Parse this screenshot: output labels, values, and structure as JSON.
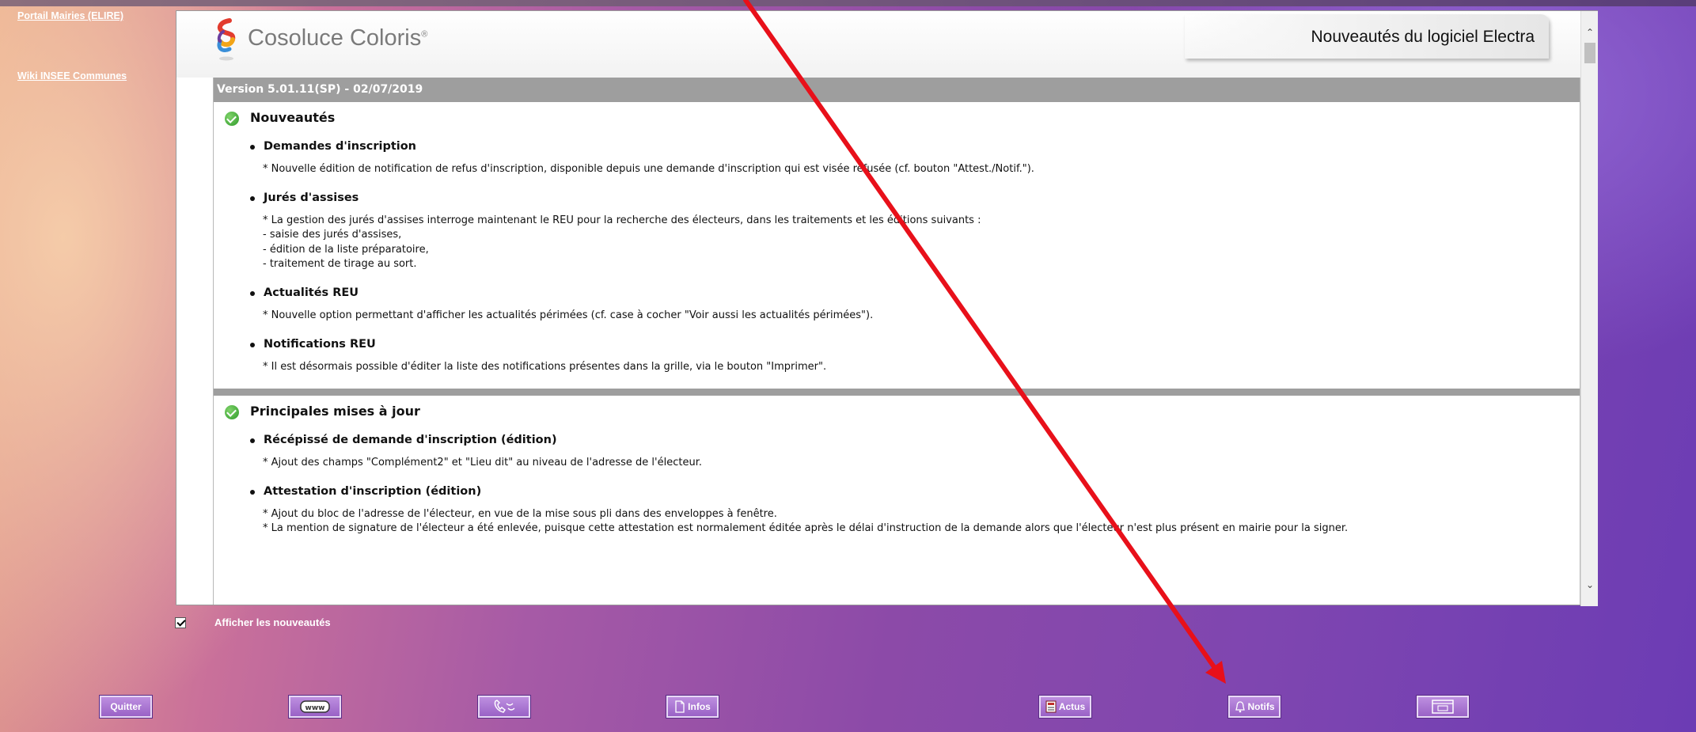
{
  "sidebar": {
    "links": [
      {
        "label": "Portail Mairies (ELIRE)"
      },
      {
        "label": "Wiki INSEE Communes"
      }
    ]
  },
  "header": {
    "brand": "Cosoluce Coloris",
    "registered": "®",
    "title": "Nouveautés du logiciel Electra"
  },
  "version": "Version 5.01.11(SP) - 02/07/2019",
  "sections": [
    {
      "title": "Nouveautés",
      "items": [
        {
          "title": "Demandes d'inscription",
          "lines": [
            "* Nouvelle édition de notification de refus d'inscription, disponible depuis une demande d'inscription qui est visée refusée (cf. bouton \"Attest./Notif.\")."
          ]
        },
        {
          "title": "Jurés d'assises",
          "lines": [
            "* La gestion des jurés d'assises interroge maintenant le REU pour la recherche des électeurs, dans les traitements et les éditions suivants :",
            "- saisie des jurés d'assises,",
            "- édition de la liste préparatoire,",
            "- traitement de tirage au sort."
          ]
        },
        {
          "title": "Actualités REU",
          "lines": [
            "* Nouvelle option permettant d'afficher les actualités périmées (cf. case à cocher \"Voir aussi les actualités périmées\")."
          ]
        },
        {
          "title": "Notifications REU",
          "lines": [
            "* Il est désormais possible d'éditer la liste des notifications présentes dans la grille, via le bouton \"Imprimer\"."
          ]
        }
      ]
    },
    {
      "title": "Principales mises à jour",
      "items": [
        {
          "title": "Récépissé de demande d'inscription (édition)",
          "lines": [
            "* Ajout des champs \"Complément2\" et \"Lieu dit\" au niveau de l'adresse de l'électeur."
          ]
        },
        {
          "title": "Attestation d'inscription (édition)",
          "lines": [
            "* Ajout du bloc de l'adresse de l'électeur, en vue de la mise sous pli dans des enveloppes à fenêtre.",
            "* La mention de signature de l'électeur a été enlevée, puisque cette attestation est normalement éditée après le délai d'instruction de la demande alors que l'électeur n'est plus présent en mairie pour la signer."
          ]
        }
      ]
    }
  ],
  "options": {
    "show_news_label": "Afficher les nouveautés",
    "show_news_checked": true
  },
  "buttons": [
    {
      "label": "Quitter",
      "icon": "none"
    },
    {
      "label": "",
      "icon": "www-icon"
    },
    {
      "label": "",
      "icon": "phone-icon"
    },
    {
      "label": "Infos",
      "icon": "document-icon"
    },
    {
      "label": "Actus",
      "icon": "news-icon"
    },
    {
      "label": "Notifs",
      "icon": "bell-icon"
    },
    {
      "label": "",
      "icon": "monitor-icon"
    }
  ],
  "colors": {
    "annotation_arrow": "#e8101a",
    "button_bg": "#a56fcf",
    "version_bar": "#9e9e9e"
  }
}
